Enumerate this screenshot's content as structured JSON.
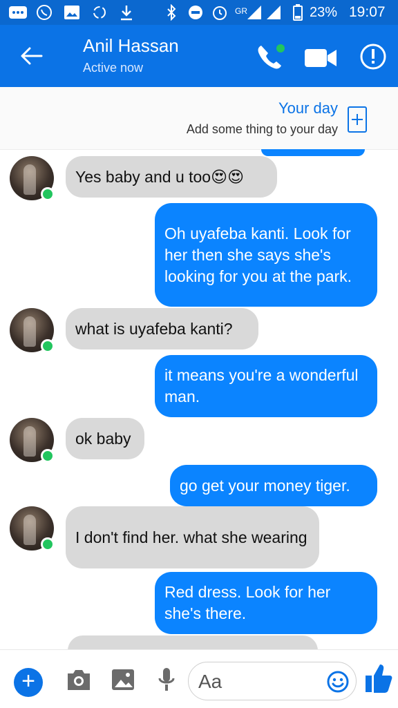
{
  "status_bar": {
    "battery": "23%",
    "time": "19:07",
    "network": "GR"
  },
  "header": {
    "contact_name": "Anil Hassan",
    "presence": "Active now"
  },
  "your_day": {
    "title": "Your day",
    "subtitle": "Add some thing to your day"
  },
  "messages": [
    {
      "side": "incoming",
      "text": "Yes baby and u too😍😍"
    },
    {
      "side": "outgoing",
      "text": "Oh uyafeba kanti. Look for her then she says she's looking for you at the park."
    },
    {
      "side": "incoming",
      "text": "what is uyafeba kanti?"
    },
    {
      "side": "outgoing",
      "text": "it means you're a wonderful man."
    },
    {
      "side": "incoming",
      "text": "ok baby"
    },
    {
      "side": "outgoing",
      "text": "go get your money tiger."
    },
    {
      "side": "incoming",
      "text": "I don't find her. what she wearing"
    },
    {
      "side": "outgoing",
      "text": "Red dress. Look for her she's there."
    }
  ],
  "composer": {
    "placeholder": "Aa"
  },
  "colors": {
    "brand": "#0b73e6",
    "outgoing_bubble": "#0b84ff",
    "incoming_bubble": "#d9d9d9",
    "online": "#22c55e"
  },
  "icons": [
    "back-arrow-icon",
    "phone-icon",
    "video-camera-icon",
    "info-icon",
    "add-story-icon",
    "plus-icon",
    "camera-icon",
    "gallery-icon",
    "mic-icon",
    "emoji-icon",
    "thumbs-up-icon"
  ]
}
